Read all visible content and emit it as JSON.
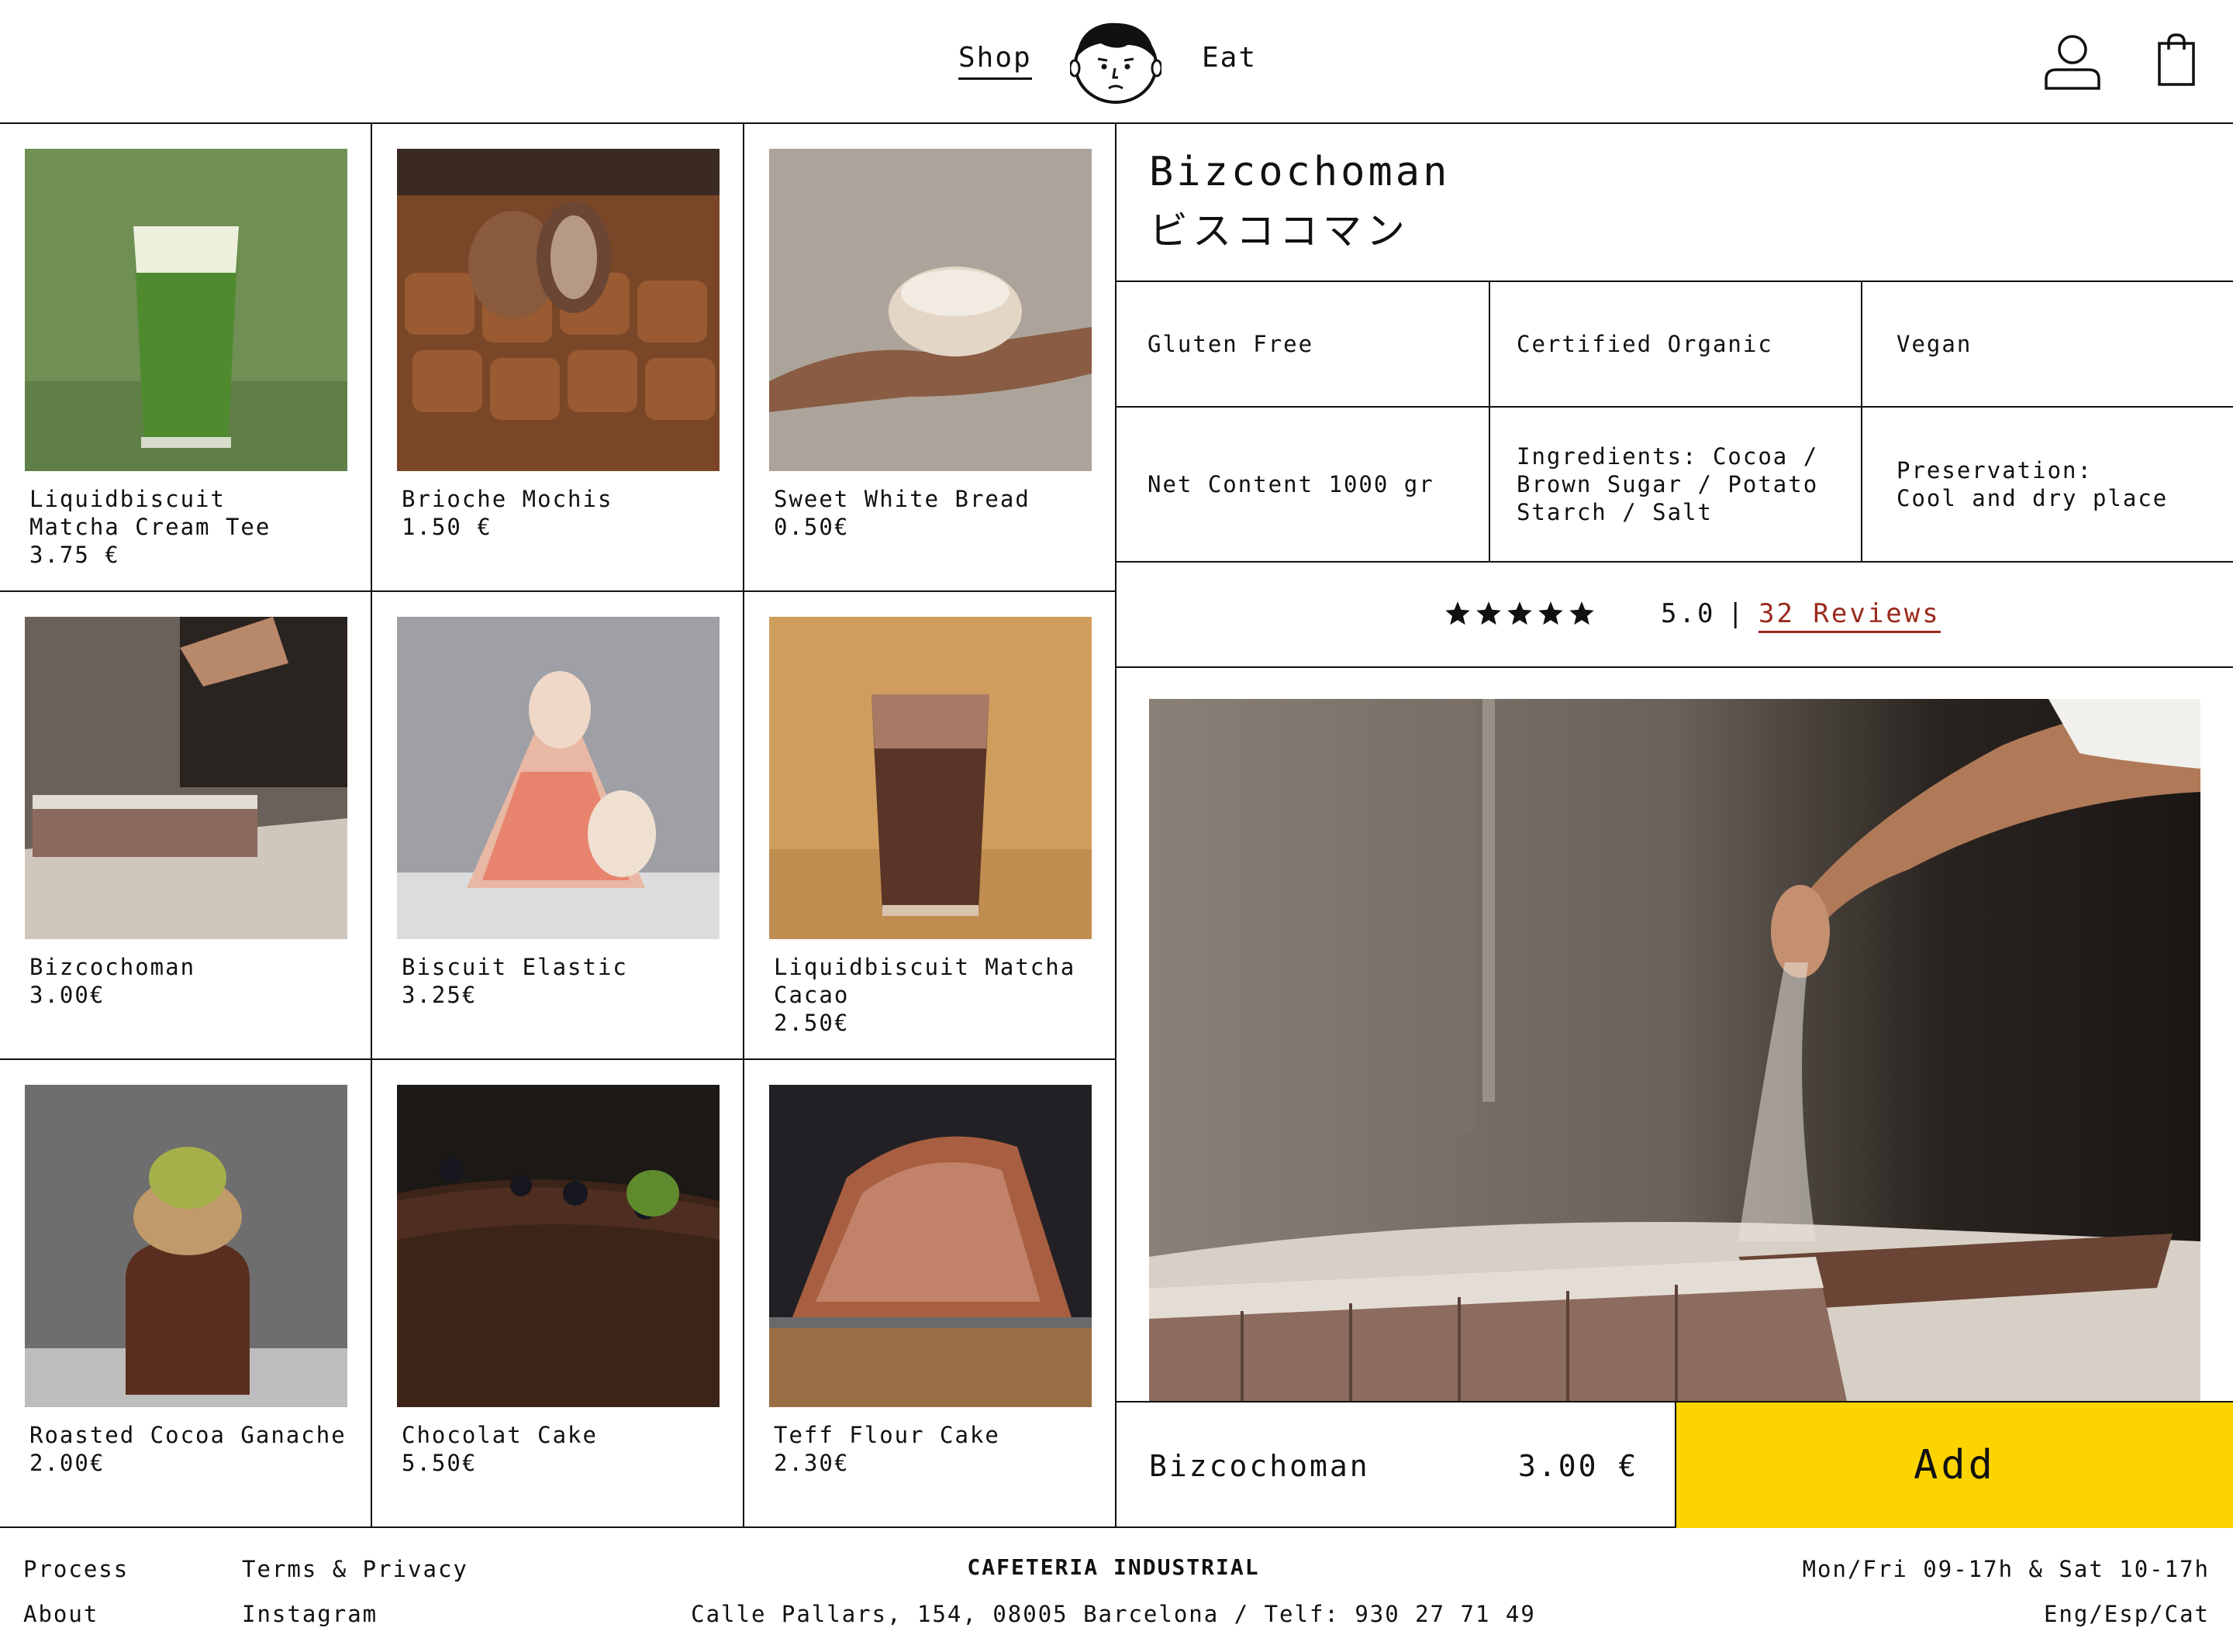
{
  "header": {
    "nav_shop": "Shop",
    "nav_eat": "Eat",
    "logo_icon": "boy-face-logo-icon",
    "user_icon": "user-icon",
    "bag_icon": "shopping-bag-icon"
  },
  "products": [
    {
      "name": "Liquidbiscuit\nMatcha Cream Tee",
      "price": "3.75 €"
    },
    {
      "name": "Brioche Mochis",
      "price": "1.50 €"
    },
    {
      "name": "Sweet White Bread",
      "price": "0.50€"
    },
    {
      "name": "Bizcochoman",
      "price": "3.00€"
    },
    {
      "name": "Biscuit Elastic",
      "price": "3.25€"
    },
    {
      "name": "Liquidbiscuit Matcha\nCacao",
      "price": "2.50€"
    },
    {
      "name": "Roasted Cocoa Ganache",
      "price": "2.00€"
    },
    {
      "name": "Chocolat Cake",
      "price": "5.50€"
    },
    {
      "name": "Teff Flour Cake",
      "price": "2.30€"
    }
  ],
  "detail": {
    "title_en": "Bizcochoman",
    "title_jp": "ビスココマン",
    "attributes": [
      "Gluten Free",
      "Certified Organic",
      "Vegan",
      "Net Content 1000 gr",
      "Ingredients: Cocoa /\nBrown Sugar / Potato\nStarch / Salt",
      "Preservation:\nCool and dry place"
    ],
    "rating": {
      "stars": 5,
      "score": "5.0",
      "separator": "|",
      "reviews_label": "32 Reviews"
    },
    "cart_name": "Bizcochoman",
    "cart_price": "3.00 €",
    "add_label": "Add"
  },
  "footer": {
    "process": "Process",
    "about": "About",
    "terms": "Terms & Privacy",
    "instagram": "Instagram",
    "brand": "CAFETERIA INDUSTRIAL",
    "address": "Calle Pallars, 154, 08005 Barcelona / Telf: 930 27 71 49",
    "hours": "Mon/Fri 09-17h & Sat 10-17h",
    "languages": "Eng/Esp/Cat"
  },
  "colors": {
    "accent_yellow": "#fcd400",
    "review_link": "#9a2a1c",
    "line": "#111111"
  }
}
